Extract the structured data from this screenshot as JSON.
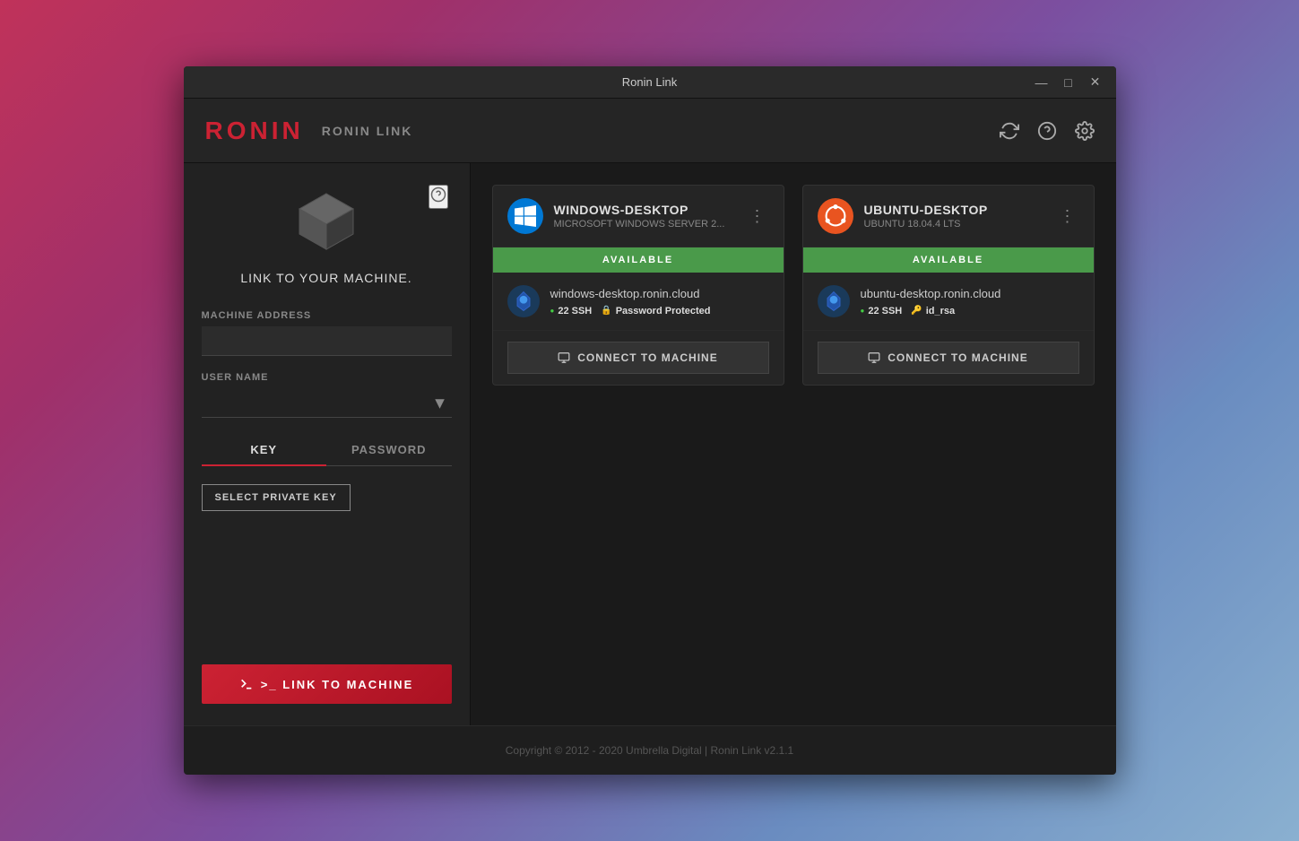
{
  "window": {
    "title": "Ronin Link",
    "controls": {
      "minimize": "—",
      "maximize": "□",
      "close": "✕"
    }
  },
  "header": {
    "logo_text": "RONIN",
    "logo_subtitle": "RONIN LINK",
    "actions": {
      "refresh_label": "⟳",
      "help_label": "?",
      "settings_label": "⚙"
    }
  },
  "left_panel": {
    "icon_alt": "machine icon",
    "title": "LINK TO YOUR MACHINE.",
    "help_tooltip": "?",
    "machine_address_label": "MACHINE ADDRESS",
    "machine_address_value": "",
    "username_label": "USER NAME",
    "username_value": "",
    "tabs": [
      {
        "id": "key",
        "label": "KEY",
        "active": true
      },
      {
        "id": "password",
        "label": "PASSWORD",
        "active": false
      }
    ],
    "select_key_button": "SELECT PRIVATE KEY",
    "link_button": ">_  LINK TO MACHINE"
  },
  "machines": [
    {
      "id": "windows-desktop",
      "name": "WINDOWS-DESKTOP",
      "os": "MICROSOFT WINDOWS SERVER 2...",
      "os_icon": "windows",
      "status": "AVAILABLE",
      "hostname": "windows-desktop.ronin.cloud",
      "ssh_port": "22 SSH",
      "auth_type": "Password Protected",
      "auth_icon": "password",
      "connect_button": "CONNECT TO MACHINE"
    },
    {
      "id": "ubuntu-desktop",
      "name": "UBUNTU-DESKTOP",
      "os": "UBUNTU 18.04.4 LTS",
      "os_icon": "ubuntu",
      "status": "AVAILABLE",
      "hostname": "ubuntu-desktop.ronin.cloud",
      "ssh_port": "22 SSH",
      "auth_type": "id_rsa",
      "auth_icon": "key",
      "connect_button": "CONNECT TO MACHINE"
    }
  ],
  "footer": {
    "copyright": "Copyright © 2012 - 2020 Umbrella Digital | Ronin Link v2.1.1"
  },
  "colors": {
    "accent": "#cc2233",
    "available": "#4a9a4a",
    "bg_dark": "#1e1e1e",
    "bg_medium": "#252525"
  }
}
